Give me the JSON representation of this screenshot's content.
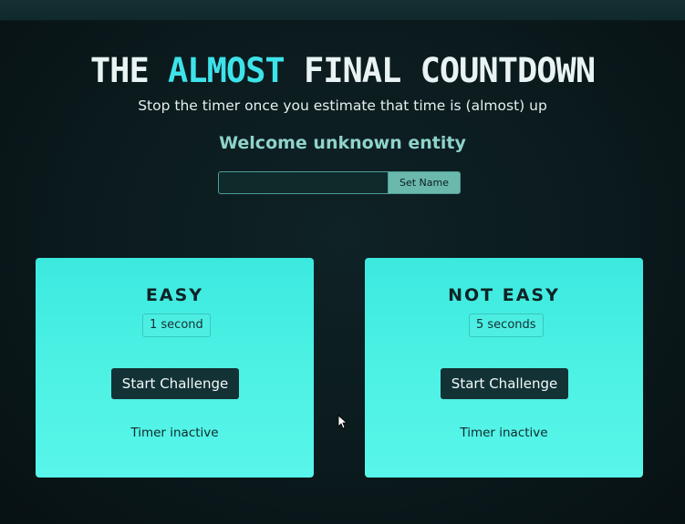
{
  "header": {
    "title_prefix": "THE",
    "title_accent": "ALMOST",
    "title_suffix": "FINAL COUNTDOWN",
    "subtitle": "Stop the timer once you estimate that time is (almost) up",
    "welcome": "Welcome unknown entity"
  },
  "name_form": {
    "input_value": "",
    "input_placeholder": "",
    "button_label": "Set Name"
  },
  "challenges": [
    {
      "title": "EASY",
      "duration": "1 second",
      "button_label": "Start Challenge",
      "status": "Timer inactive"
    },
    {
      "title": "NOT EASY",
      "duration": "5 seconds",
      "button_label": "Start Challenge",
      "status": "Timer inactive"
    }
  ],
  "colors": {
    "accent": "#3ee3ea",
    "card": "#4ef2e4",
    "button": "#133236",
    "background": "#0b1a1d"
  },
  "icons": {
    "cursor": "mouse-pointer-icon"
  }
}
